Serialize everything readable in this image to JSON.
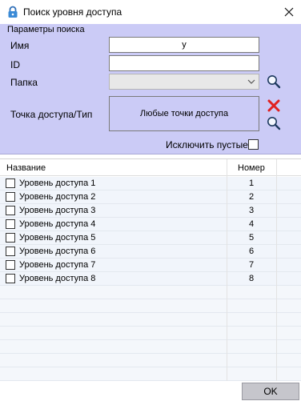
{
  "window": {
    "title": "Поиск уровня доступа"
  },
  "params": {
    "title": "Параметры поиска",
    "name_label": "Имя",
    "name_value": "у",
    "id_label": "ID",
    "id_value": "",
    "folder_label": "Папка",
    "folder_value": "",
    "access_point_label": "Точка доступа/Тип",
    "access_point_value": "Любые точки доступа",
    "exclude_empty_label": "Исключить пустые"
  },
  "grid": {
    "headers": {
      "name": "Название",
      "number": "Номер"
    },
    "rows": [
      {
        "name": "Уровень доступа 1",
        "number": "1"
      },
      {
        "name": "Уровень доступа 2",
        "number": "2"
      },
      {
        "name": "Уровень доступа 3",
        "number": "3"
      },
      {
        "name": "Уровень доступа 4",
        "number": "4"
      },
      {
        "name": "Уровень доступа 5",
        "number": "5"
      },
      {
        "name": "Уровень доступа 6",
        "number": "6"
      },
      {
        "name": "Уровень доступа 7",
        "number": "7"
      },
      {
        "name": "Уровень доступа 8",
        "number": "8"
      }
    ]
  },
  "footer": {
    "ok_label": "OK"
  },
  "icons": {
    "lock": "lock-icon",
    "close": "close-icon",
    "search": "search-icon",
    "clear": "clear-icon",
    "dropdown": "chevron-down-icon"
  },
  "colors": {
    "panel_bg": "#cbcbf6",
    "row_bg": "#f1f5fb",
    "clear_red": "#e02020",
    "ok_bg": "#c6c6cc"
  }
}
